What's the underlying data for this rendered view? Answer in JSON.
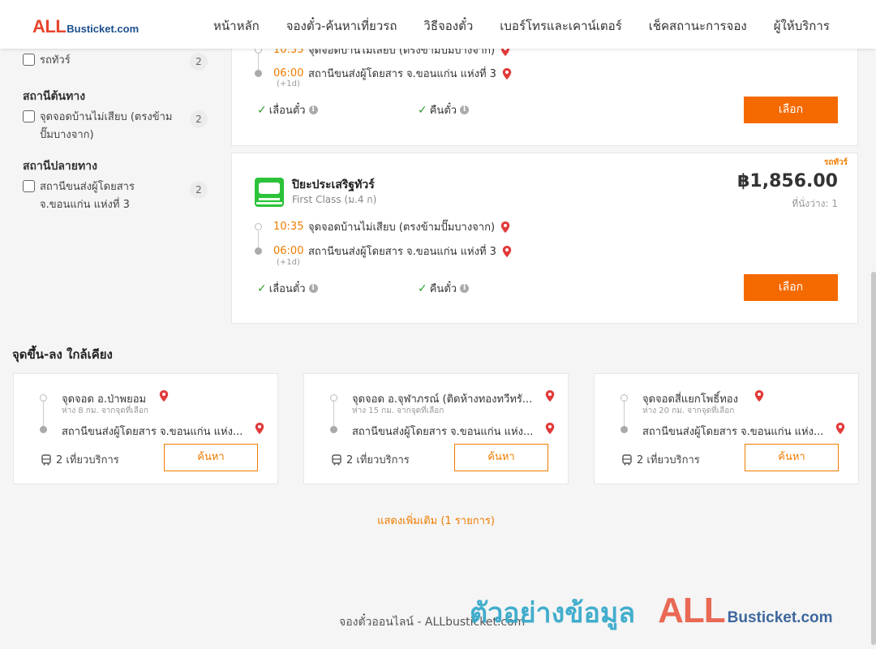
{
  "header": {
    "logo_all": "ALL",
    "logo_rest": "Busticket.com",
    "nav": [
      "หน้าหลัก",
      "จองตั๋ว-ค้นหาเที่ยวรถ",
      "วิธีจองตั๋ว",
      "เบอร์โทรและเคาน์เตอร์",
      "เช็คสถานะการจอง",
      "ผู้ให้บริการ"
    ]
  },
  "filters": {
    "tour": {
      "label": "รถทัวร์",
      "count": "2"
    },
    "origin_title": "สถานีต้นทาง",
    "origin": {
      "label": "จุดจอดบ้านไม่เสียบ (ตรงข้ามปั๊มบางจาก)",
      "count": "2"
    },
    "destination_title": "สถานีปลายทาง",
    "destination": {
      "label": "สถานีขนส่งผู้โดยสาร จ.ขอนแก่น แห่งที่ 3",
      "count": "2"
    }
  },
  "card1": {
    "depart_time": "10:35",
    "depart_stop": "จุดจอดบ้านไม่เสียบ (ตรงข้ามปั๊มบางจาก)",
    "arrive_time": "06:00",
    "arrive_stop": "สถานีขนส่งผู้โดยสาร จ.ขอนแก่น แห่งที่ 3",
    "next_day": "(+1d)",
    "feature1": "เลื่อนตั๋ว",
    "feature2": "คืนตั๋ว",
    "select": "เลือก"
  },
  "card2": {
    "tag": "รถทัวร์",
    "operator": "ปิยะประเสริฐทัวร์",
    "class": "First Class (ม.4 ก)",
    "price": "฿1,856.00",
    "seats": "ที่นั่งว่าง: 1",
    "depart_time": "10:35",
    "depart_stop": "จุดจอดบ้านไม่เสียบ (ตรงข้ามปั๊มบางจาก)",
    "arrive_time": "06:00",
    "arrive_stop": "สถานีขนส่งผู้โดยสาร จ.ขอนแก่น แห่งที่ 3",
    "next_day": "(+1d)",
    "feature1": "เลื่อนตั๋ว",
    "feature2": "คืนตั๋ว",
    "select": "เลือก"
  },
  "nearby": {
    "title": "จุดขึ้น-ลง ใกล้เคียง",
    "items": [
      {
        "stop": "จุดจอด อ.ป่าพยอม",
        "distance": "ห่าง 8 กม. จากจุดที่เลือก",
        "dest": "สถานีขนส่งผู้โดยสาร จ.ขอนแก่น แห่ง...",
        "trips": "2 เที่ยวบริการ",
        "button": "ค้นหา"
      },
      {
        "stop": "จุดจอด อ.จุฬาภรณ์ (ติดห้างทองทวีทรั...",
        "distance": "ห่าง 15 กม. จากจุดที่เลือก",
        "dest": "สถานีขนส่งผู้โดยสาร จ.ขอนแก่น แห่ง...",
        "trips": "2 เที่ยวบริการ",
        "button": "ค้นหา"
      },
      {
        "stop": "จุดจอดสี่แยกโพธิ์ทอง",
        "distance": "ห่าง 20 กม. จากจุดที่เลือก",
        "dest": "สถานีขนส่งผู้โดยสาร จ.ขอนแก่น แห่ง...",
        "trips": "2 เที่ยวบริการ",
        "button": "ค้นหา"
      }
    ]
  },
  "show_more": "แสดงเพิ่มเติม (1 รายการ)",
  "footer": "จองตั๋วออนไลน์ - ALLbusticket.com",
  "watermark": {
    "text": "ตัวอย่างข้อมูล",
    "all": "ALL",
    "rest": "Busticket.com"
  },
  "colors": {
    "accent": "#f56a00",
    "brand_red": "#e8442c",
    "brand_blue": "#1d4f8f",
    "check_green": "#2f9e2f"
  }
}
